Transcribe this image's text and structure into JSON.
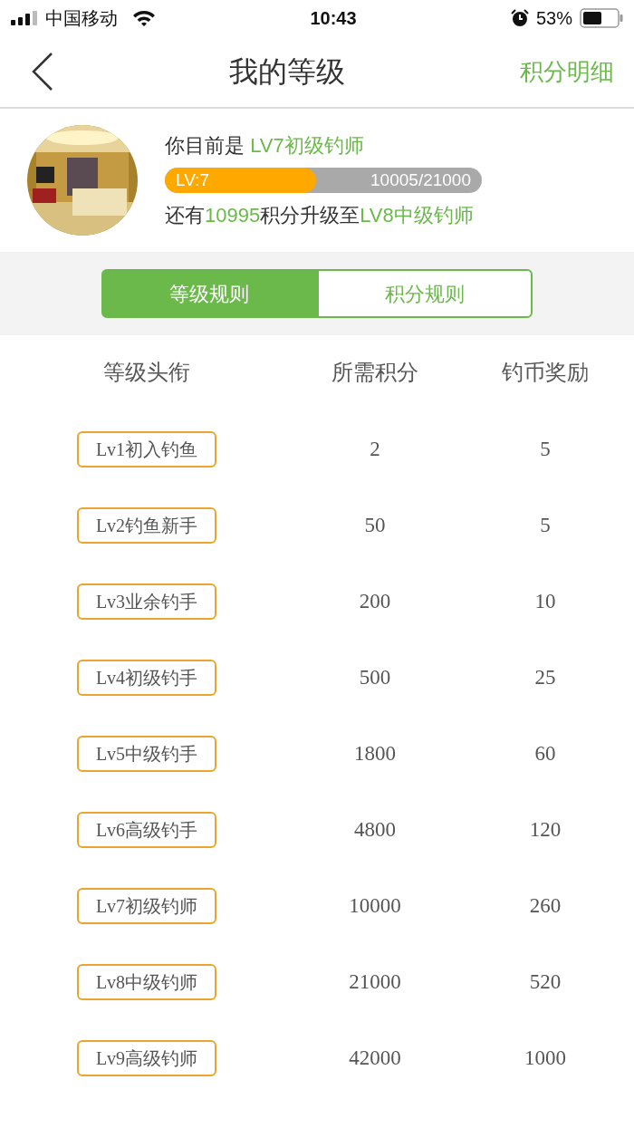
{
  "status_bar": {
    "carrier": "中国移动",
    "time": "10:43",
    "battery": "53%"
  },
  "nav": {
    "title": "我的等级",
    "action": "积分明细"
  },
  "profile": {
    "current_line": [
      {
        "text": "你目前是 ",
        "highlight": false
      },
      {
        "text": "LV7初级钓师",
        "highlight": true
      }
    ],
    "progress": {
      "label": "LV:7",
      "reading": "10005/21000",
      "level": 0.476
    },
    "next_line": [
      {
        "text": "还有",
        "highlight": false
      },
      {
        "text": "10995",
        "highlight": true
      },
      {
        "text": "积分升级至",
        "highlight": false
      },
      {
        "text": "LV8中级钓师",
        "highlight": true
      }
    ]
  },
  "tabs": [
    {
      "label": "等级规则",
      "selected": true
    },
    {
      "label": "积分规则",
      "selected": false
    }
  ],
  "table": {
    "columns": [
      "等级头衔",
      "所需积分",
      "钓币奖励"
    ],
    "rows": [
      {
        "title": "Lv1初入钓鱼",
        "points": "2",
        "coins": "5"
      },
      {
        "title": "Lv2钓鱼新手",
        "points": "50",
        "coins": "5"
      },
      {
        "title": "Lv3业余钓手",
        "points": "200",
        "coins": "10"
      },
      {
        "title": "Lv4初级钓手",
        "points": "500",
        "coins": "25"
      },
      {
        "title": "Lv5中级钓手",
        "points": "1800",
        "coins": "60"
      },
      {
        "title": "Lv6高级钓手",
        "points": "4800",
        "coins": "120"
      },
      {
        "title": "Lv7初级钓师",
        "points": "10000",
        "coins": "260"
      },
      {
        "title": "Lv8中级钓师",
        "points": "21000",
        "coins": "520"
      },
      {
        "title": "Lv9高级钓师",
        "points": "42000",
        "coins": "1000"
      }
    ]
  }
}
